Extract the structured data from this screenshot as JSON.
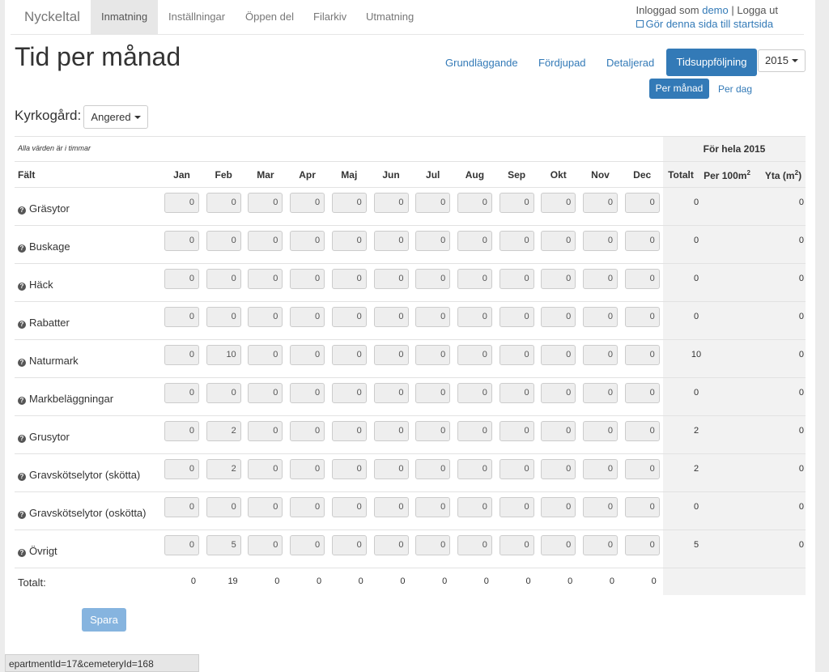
{
  "nav": {
    "brand": "Nyckeltal",
    "items": [
      "Inmatning",
      "Inställningar",
      "Öppen del",
      "Filarkiv",
      "Utmatning"
    ],
    "active_index": 0
  },
  "user": {
    "logged_in_prefix": "Inloggad som",
    "username": "demo",
    "separator": "|",
    "logout": "Logga ut",
    "startpage": "Gör denna sida till startsida"
  },
  "page_title": "Tid per månad",
  "views": {
    "basic": "Grundläggande",
    "advanced": "Fördjupad",
    "detailed": "Detaljerad",
    "followup": "Tidsuppföljning",
    "year": "2015"
  },
  "subviews": {
    "per_month": "Per månad",
    "per_day": "Per dag"
  },
  "cemetery": {
    "label": "Kyrkogård:",
    "selected": "Angered"
  },
  "table": {
    "note": "Alla värden är i timmar",
    "summary_header": "För hela 2015",
    "field_header": "Fält",
    "months": [
      "Jan",
      "Feb",
      "Mar",
      "Apr",
      "Maj",
      "Jun",
      "Jul",
      "Aug",
      "Sep",
      "Okt",
      "Nov",
      "Dec"
    ],
    "col_total": "Totalt",
    "col_per100": "Per 100m",
    "col_yta": "Yta (m",
    "sup2": "2",
    "close_paren": ")",
    "rows": [
      {
        "label": "Gräsytor",
        "values": [
          "0",
          "0",
          "0",
          "0",
          "0",
          "0",
          "0",
          "0",
          "0",
          "0",
          "0",
          "0"
        ],
        "total": "0",
        "per100": "",
        "yta": "0"
      },
      {
        "label": "Buskage",
        "values": [
          "0",
          "0",
          "0",
          "0",
          "0",
          "0",
          "0",
          "0",
          "0",
          "0",
          "0",
          "0"
        ],
        "total": "0",
        "per100": "",
        "yta": "0"
      },
      {
        "label": "Häck",
        "values": [
          "0",
          "0",
          "0",
          "0",
          "0",
          "0",
          "0",
          "0",
          "0",
          "0",
          "0",
          "0"
        ],
        "total": "0",
        "per100": "",
        "yta": "0"
      },
      {
        "label": "Rabatter",
        "values": [
          "0",
          "0",
          "0",
          "0",
          "0",
          "0",
          "0",
          "0",
          "0",
          "0",
          "0",
          "0"
        ],
        "total": "0",
        "per100": "",
        "yta": "0"
      },
      {
        "label": "Naturmark",
        "values": [
          "0",
          "10",
          "0",
          "0",
          "0",
          "0",
          "0",
          "0",
          "0",
          "0",
          "0",
          "0"
        ],
        "total": "10",
        "per100": "",
        "yta": "0"
      },
      {
        "label": "Markbeläggningar",
        "values": [
          "0",
          "0",
          "0",
          "0",
          "0",
          "0",
          "0",
          "0",
          "0",
          "0",
          "0",
          "0"
        ],
        "total": "0",
        "per100": "",
        "yta": "0"
      },
      {
        "label": "Grusytor",
        "values": [
          "0",
          "2",
          "0",
          "0",
          "0",
          "0",
          "0",
          "0",
          "0",
          "0",
          "0",
          "0"
        ],
        "total": "2",
        "per100": "",
        "yta": "0"
      },
      {
        "label": "Gravskötselytor (skötta)",
        "values": [
          "0",
          "2",
          "0",
          "0",
          "0",
          "0",
          "0",
          "0",
          "0",
          "0",
          "0",
          "0"
        ],
        "total": "2",
        "per100": "",
        "yta": "0"
      },
      {
        "label": "Gravskötselytor (oskötta)",
        "values": [
          "0",
          "0",
          "0",
          "0",
          "0",
          "0",
          "0",
          "0",
          "0",
          "0",
          "0",
          "0"
        ],
        "total": "0",
        "per100": "",
        "yta": "0"
      },
      {
        "label": "Övrigt",
        "values": [
          "0",
          "5",
          "0",
          "0",
          "0",
          "0",
          "0",
          "0",
          "0",
          "0",
          "0",
          "0"
        ],
        "total": "5",
        "per100": "",
        "yta": "0"
      }
    ],
    "totals_label": "Totalt:",
    "totals": [
      "0",
      "19",
      "0",
      "0",
      "0",
      "0",
      "0",
      "0",
      "0",
      "0",
      "0",
      "0"
    ]
  },
  "save_label": "Spara",
  "status_url": "epartmentId=17&cemeteryId=168"
}
